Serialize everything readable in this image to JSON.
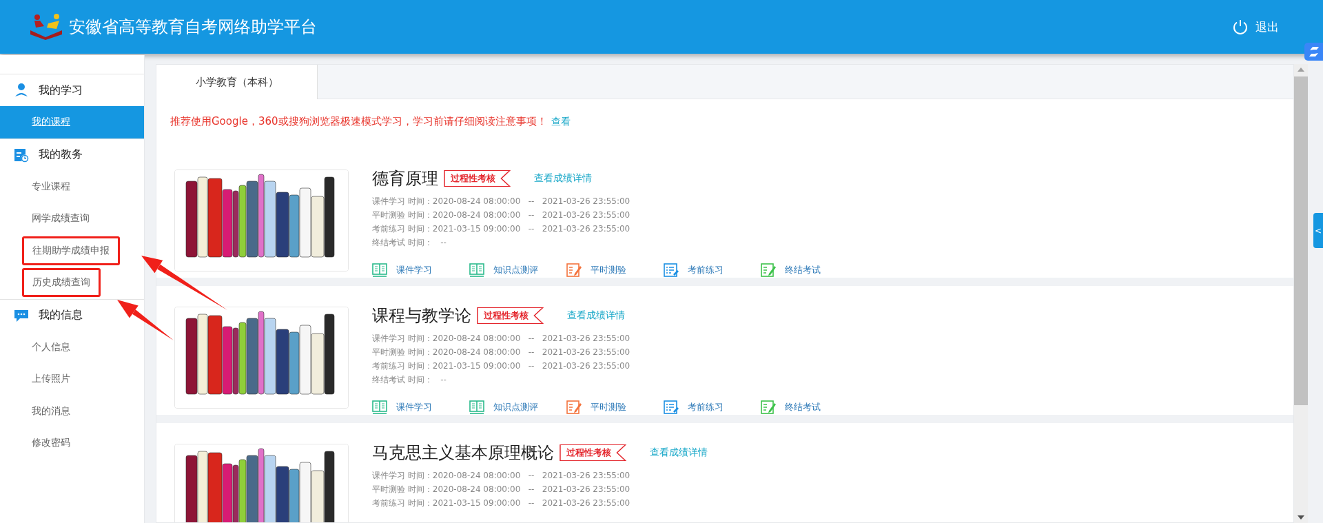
{
  "header": {
    "title": "安徽省高等教育自考网络助学平台",
    "logout": "退出"
  },
  "sidebar": {
    "sections": [
      {
        "title": "我的学习",
        "items": [
          {
            "label": "我的课程",
            "selected": true,
            "highlighted": false
          }
        ]
      },
      {
        "title": "我的教务",
        "items": [
          {
            "label": "专业课程",
            "selected": false,
            "highlighted": false
          },
          {
            "label": "网学成绩查询",
            "selected": false,
            "highlighted": false
          },
          {
            "label": "往期助学成绩申报",
            "selected": false,
            "highlighted": true
          },
          {
            "label": "历史成绩查询",
            "selected": false,
            "highlighted": true
          }
        ]
      },
      {
        "title": "我的信息",
        "items": [
          {
            "label": "个人信息",
            "selected": false,
            "highlighted": false
          },
          {
            "label": "上传照片",
            "selected": false,
            "highlighted": false
          },
          {
            "label": "我的消息",
            "selected": false,
            "highlighted": false
          },
          {
            "label": "修改密码",
            "selected": false,
            "highlighted": false
          }
        ]
      }
    ]
  },
  "tabs": [
    {
      "label": "小学教育（本科）",
      "selected": true
    }
  ],
  "notice": {
    "text": "推荐使用Google，360或搜狗浏览器极速模式学习，学习前请仔细阅读注意事项！",
    "link": "查看"
  },
  "courses": [
    {
      "title": "德育原理",
      "badge": "过程性考核",
      "link": "查看成绩详情",
      "times": [
        "课件学习 时间：2020-08-24 08:00:00   --   2021-03-26 23:55:00",
        "平时测验 时间：2020-08-24 08:00:00   --   2021-03-26 23:55:00",
        "考前练习 时间：2021-03-15 09:00:00   --   2021-03-26 23:55:00",
        "终结考试 时间：   --"
      ],
      "actions": [
        {
          "label": "课件学习"
        },
        {
          "label": "知识点测评"
        },
        {
          "label": "平时测验"
        },
        {
          "label": "考前练习"
        },
        {
          "label": "终结考试"
        }
      ]
    },
    {
      "title": "课程与教学论",
      "badge": "过程性考核",
      "link": "查看成绩详情",
      "times": [
        "课件学习 时间：2020-08-24 08:00:00   --   2021-03-26 23:55:00",
        "平时测验 时间：2020-08-24 08:00:00   --   2021-03-26 23:55:00",
        "考前练习 时间：2021-03-15 09:00:00   --   2021-03-26 23:55:00",
        "终结考试 时间：   --"
      ],
      "actions": [
        {
          "label": "课件学习"
        },
        {
          "label": "知识点测评"
        },
        {
          "label": "平时测验"
        },
        {
          "label": "考前练习"
        },
        {
          "label": "终结考试"
        }
      ]
    },
    {
      "title": "马克思主义基本原理概论",
      "badge": "过程性考核",
      "link": "查看成绩详情",
      "times": [
        "课件学习 时间：2020-08-24 08:00:00   --   2021-03-26 23:55:00",
        "平时测验 时间：2020-08-24 08:00:00   --   2021-03-26 23:55:00",
        "考前练习 时间：2021-03-15 09:00:00   --   2021-03-26 23:55:00"
      ]
    }
  ],
  "side_tab": {
    "label": "<"
  }
}
